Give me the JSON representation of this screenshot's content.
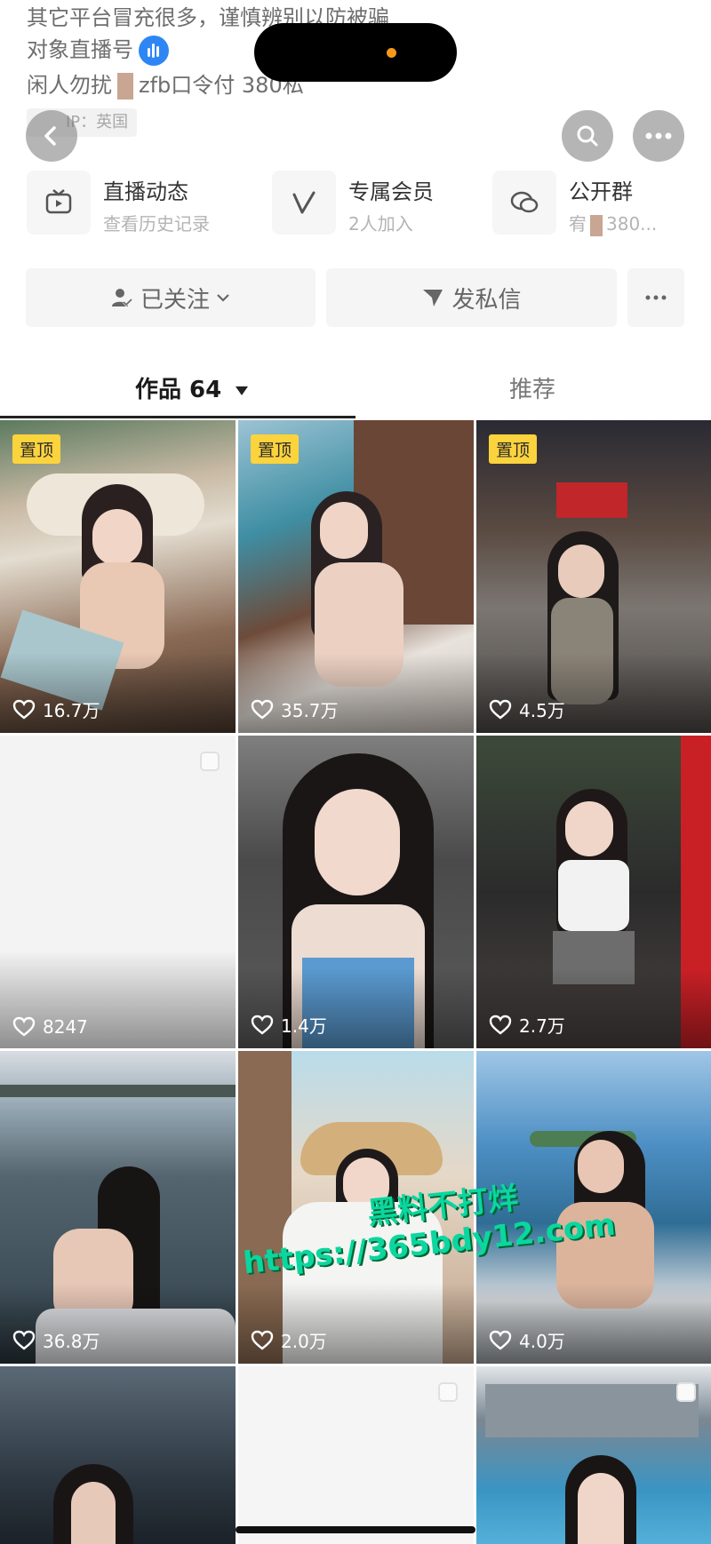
{
  "profile": {
    "bio_line1": "其它平台冒充很多，谨慎辨别以防被骗",
    "bio_line2_prefix": "对象直播号",
    "bio_line3_prefix": "闲人勿扰",
    "bio_line3_suffix": "zfb口令付 380私",
    "ip_label": "IP：英国"
  },
  "features": [
    {
      "title": "直播动态",
      "sub": "查看历史记录",
      "icon": "tv-icon"
    },
    {
      "title": "专属会员",
      "sub": "2人加入",
      "icon": "vip-v-icon"
    },
    {
      "title": "公开群",
      "sub": "380...",
      "sub_prefix": "宥",
      "icon": "chat-group-icon"
    }
  ],
  "actions": {
    "follow_label": "已关注",
    "message_label": "发私信"
  },
  "tabs": {
    "works": "作品 64",
    "recommend": "推荐"
  },
  "pin_label": "置顶",
  "grid": [
    {
      "likes": "16.7万",
      "pinned": true
    },
    {
      "likes": "35.7万",
      "pinned": true
    },
    {
      "likes": "4.5万",
      "pinned": true
    },
    {
      "likes": "8247",
      "pinned": false
    },
    {
      "likes": "1.4万",
      "pinned": false
    },
    {
      "likes": "2.7万",
      "pinned": false
    },
    {
      "likes": "36.8万",
      "pinned": false
    },
    {
      "likes": "2.0万",
      "pinned": false
    },
    {
      "likes": "4.0万",
      "pinned": false
    },
    {
      "likes": "",
      "pinned": false
    },
    {
      "likes": "",
      "pinned": false
    },
    {
      "likes": "",
      "pinned": false
    }
  ],
  "watermark": {
    "line1": "黑料不打烊",
    "line2": "https://365bdy12.com"
  }
}
